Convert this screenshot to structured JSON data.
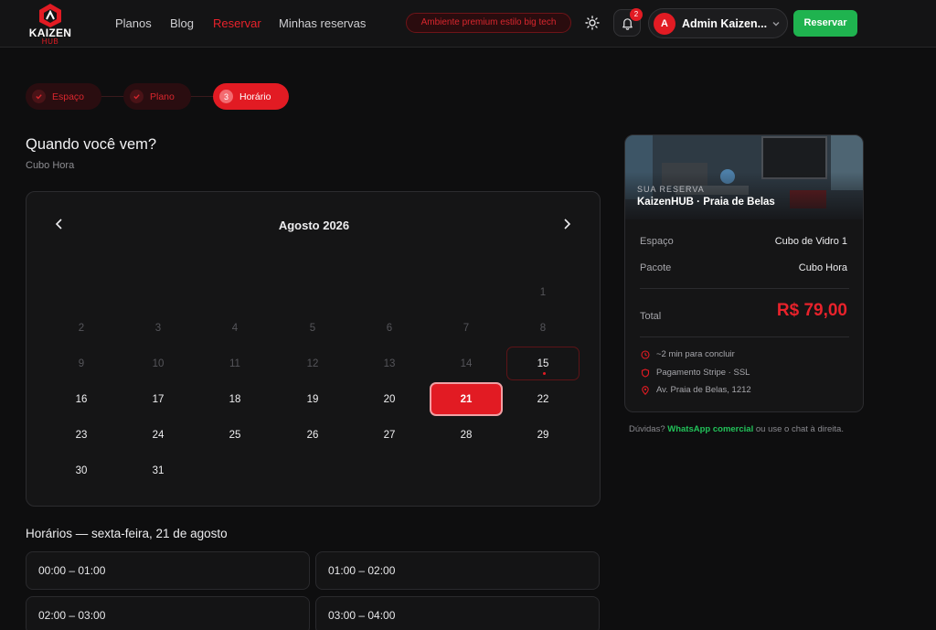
{
  "brand": {
    "logo_text": "KAIZEN",
    "logo_sub": "HUB",
    "accent": "#e21b23",
    "success": "#1fb34f"
  },
  "nav": [
    {
      "label": "Planos",
      "active": false
    },
    {
      "label": "Blog",
      "active": false
    },
    {
      "label": "Reservar",
      "active": true
    },
    {
      "label": "Minhas reservas",
      "active": false
    }
  ],
  "header": {
    "env_pill": "Ambiente premium estilo big tech",
    "theme_icon": "sun-icon",
    "bell_icon": "bell-icon",
    "notifications": "2",
    "user_initial": "A",
    "user_name": "Admin Kaizen...",
    "cta": "Reservar"
  },
  "stepper": [
    {
      "num": "",
      "label": "Espaço",
      "state": "done"
    },
    {
      "num": "",
      "label": "Plano",
      "state": "done"
    },
    {
      "num": "3",
      "label": "Horário",
      "state": "current"
    }
  ],
  "page": {
    "title": "Quando você vem?",
    "subtitle": "Cubo Hora"
  },
  "calendar": {
    "month_label": "Agosto 2026",
    "weeks": [
      [
        "",
        "",
        "",
        "",
        "",
        "",
        "1"
      ],
      [
        "2",
        "3",
        "4",
        "5",
        "6",
        "7",
        "8"
      ],
      [
        "9",
        "10",
        "11",
        "12",
        "13",
        "14",
        "15"
      ],
      [
        "16",
        "17",
        "18",
        "19",
        "20",
        "21",
        "22"
      ],
      [
        "23",
        "24",
        "25",
        "26",
        "27",
        "28",
        "29"
      ],
      [
        "30",
        "31",
        "",
        "",
        "",
        "",
        ""
      ]
    ],
    "today": "15",
    "selected": "21",
    "past_days": [
      "1",
      "2",
      "3",
      "4",
      "5",
      "6",
      "7",
      "8",
      "9",
      "10",
      "11",
      "12",
      "13",
      "14"
    ]
  },
  "slots": {
    "title": "Horários — sexta-feira, 21 de agosto",
    "items": [
      "00:00 – 01:00",
      "01:00 – 02:00",
      "02:00 – 03:00",
      "03:00 – 04:00"
    ]
  },
  "summary": {
    "kicker": "SUA RESERVA",
    "title": "KaizenHUB · Praia de Belas",
    "space_label": "Espaço",
    "space_value": "Cubo de Vidro 1",
    "package_label": "Pacote",
    "package_value": "Cubo Hora",
    "total_label": "Total",
    "total_value": "R$ 79,00",
    "info": [
      {
        "icon": "clock-icon",
        "text": "~2 min para concluir"
      },
      {
        "icon": "shield-icon",
        "text": "Pagamento Stripe · SSL"
      },
      {
        "icon": "location-pin-icon",
        "text": "Av. Praia de Belas, 1212"
      }
    ]
  },
  "help": {
    "prefix": "Dúvidas?",
    "link": "WhatsApp comercial",
    "suffix": "ou use o chat à direita."
  }
}
